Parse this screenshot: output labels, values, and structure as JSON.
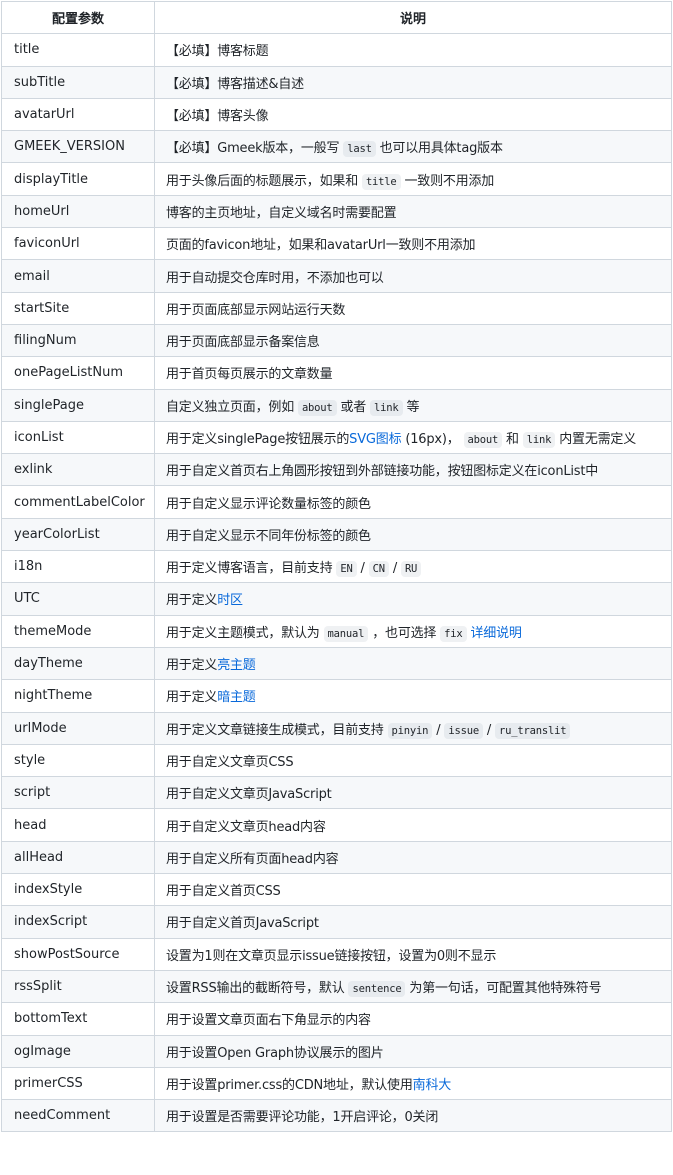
{
  "header": {
    "param": "配置参数",
    "desc": "说明"
  },
  "rows": [
    {
      "key": "title",
      "parts": [
        {
          "t": "text",
          "v": "【必填】博客标题"
        }
      ]
    },
    {
      "key": "subTitle",
      "parts": [
        {
          "t": "text",
          "v": "【必填】博客描述&自述"
        }
      ]
    },
    {
      "key": "avatarUrl",
      "parts": [
        {
          "t": "text",
          "v": "【必填】博客头像"
        }
      ]
    },
    {
      "key": "GMEEK_VERSION",
      "parts": [
        {
          "t": "text",
          "v": "【必填】Gmeek版本，一般写 "
        },
        {
          "t": "code",
          "v": "last"
        },
        {
          "t": "text",
          "v": " 也可以用具体tag版本"
        }
      ]
    },
    {
      "key": "displayTitle",
      "parts": [
        {
          "t": "text",
          "v": "用于头像后面的标题展示，如果和 "
        },
        {
          "t": "code",
          "v": "title"
        },
        {
          "t": "text",
          "v": " 一致则不用添加"
        }
      ]
    },
    {
      "key": "homeUrl",
      "parts": [
        {
          "t": "text",
          "v": "博客的主页地址，自定义域名时需要配置"
        }
      ]
    },
    {
      "key": "faviconUrl",
      "parts": [
        {
          "t": "text",
          "v": "页面的favicon地址，如果和avatarUrl一致则不用添加"
        }
      ]
    },
    {
      "key": "email",
      "parts": [
        {
          "t": "text",
          "v": "用于自动提交仓库时用，不添加也可以"
        }
      ]
    },
    {
      "key": "startSite",
      "parts": [
        {
          "t": "text",
          "v": "用于页面底部显示网站运行天数"
        }
      ]
    },
    {
      "key": "filingNum",
      "parts": [
        {
          "t": "text",
          "v": "用于页面底部显示备案信息"
        }
      ]
    },
    {
      "key": "onePageListNum",
      "parts": [
        {
          "t": "text",
          "v": "用于首页每页展示的文章数量"
        }
      ]
    },
    {
      "key": "singlePage",
      "parts": [
        {
          "t": "text",
          "v": "自定义独立页面，例如 "
        },
        {
          "t": "code",
          "v": "about"
        },
        {
          "t": "text",
          "v": " 或者 "
        },
        {
          "t": "code",
          "v": "link"
        },
        {
          "t": "text",
          "v": " 等"
        }
      ]
    },
    {
      "key": "iconList",
      "parts": [
        {
          "t": "text",
          "v": "用于定义singlePage按钮展示的"
        },
        {
          "t": "link",
          "v": "SVG图标"
        },
        {
          "t": "text",
          "v": " (16px)， "
        },
        {
          "t": "code",
          "v": "about"
        },
        {
          "t": "text",
          "v": " 和 "
        },
        {
          "t": "code",
          "v": "link"
        },
        {
          "t": "text",
          "v": " 内置无需定义"
        }
      ]
    },
    {
      "key": "exlink",
      "parts": [
        {
          "t": "text",
          "v": "用于自定义首页右上角圆形按钮到外部链接功能，按钮图标定义在iconList中"
        }
      ]
    },
    {
      "key": "commentLabelColor",
      "parts": [
        {
          "t": "text",
          "v": "用于自定义显示评论数量标签的颜色"
        }
      ]
    },
    {
      "key": "yearColorList",
      "parts": [
        {
          "t": "text",
          "v": "用于自定义显示不同年份标签的颜色"
        }
      ]
    },
    {
      "key": "i18n",
      "parts": [
        {
          "t": "text",
          "v": "用于定义博客语言，目前支持 "
        },
        {
          "t": "code",
          "v": "EN"
        },
        {
          "t": "text",
          "v": " / "
        },
        {
          "t": "code",
          "v": "CN"
        },
        {
          "t": "text",
          "v": " / "
        },
        {
          "t": "code",
          "v": "RU"
        }
      ]
    },
    {
      "key": "UTC",
      "parts": [
        {
          "t": "text",
          "v": "用于定义"
        },
        {
          "t": "link",
          "v": "时区"
        }
      ]
    },
    {
      "key": "themeMode",
      "parts": [
        {
          "t": "text",
          "v": "用于定义主题模式，默认为 "
        },
        {
          "t": "code",
          "v": "manual"
        },
        {
          "t": "text",
          "v": " ，也可选择 "
        },
        {
          "t": "code",
          "v": "fix"
        },
        {
          "t": "text",
          "v": " "
        },
        {
          "t": "link",
          "v": "详细说明"
        }
      ]
    },
    {
      "key": "dayTheme",
      "parts": [
        {
          "t": "text",
          "v": "用于定义"
        },
        {
          "t": "link",
          "v": "亮主题"
        }
      ]
    },
    {
      "key": "nightTheme",
      "parts": [
        {
          "t": "text",
          "v": "用于定义"
        },
        {
          "t": "link",
          "v": "暗主题"
        }
      ]
    },
    {
      "key": "urlMode",
      "parts": [
        {
          "t": "text",
          "v": "用于定义文章链接生成模式，目前支持 "
        },
        {
          "t": "code",
          "v": "pinyin"
        },
        {
          "t": "text",
          "v": " / "
        },
        {
          "t": "code",
          "v": "issue"
        },
        {
          "t": "text",
          "v": " / "
        },
        {
          "t": "code",
          "v": "ru_translit"
        }
      ]
    },
    {
      "key": "style",
      "parts": [
        {
          "t": "text",
          "v": "用于自定义文章页CSS"
        }
      ]
    },
    {
      "key": "script",
      "parts": [
        {
          "t": "text",
          "v": "用于自定义文章页JavaScript"
        }
      ]
    },
    {
      "key": "head",
      "parts": [
        {
          "t": "text",
          "v": "用于自定义文章页head内容"
        }
      ]
    },
    {
      "key": "allHead",
      "parts": [
        {
          "t": "text",
          "v": "用于自定义所有页面head内容"
        }
      ]
    },
    {
      "key": "indexStyle",
      "parts": [
        {
          "t": "text",
          "v": "用于自定义首页CSS"
        }
      ]
    },
    {
      "key": "indexScript",
      "parts": [
        {
          "t": "text",
          "v": "用于自定义首页JavaScript"
        }
      ]
    },
    {
      "key": "showPostSource",
      "parts": [
        {
          "t": "text",
          "v": "设置为1则在文章页显示issue链接按钮，设置为0则不显示"
        }
      ]
    },
    {
      "key": "rssSplit",
      "parts": [
        {
          "t": "text",
          "v": "设置RSS输出的截断符号，默认 "
        },
        {
          "t": "code",
          "v": "sentence"
        },
        {
          "t": "text",
          "v": " 为第一句话，可配置其他特殊符号"
        }
      ]
    },
    {
      "key": "bottomText",
      "parts": [
        {
          "t": "text",
          "v": "用于设置文章页面右下角显示的内容"
        }
      ]
    },
    {
      "key": "ogImage",
      "parts": [
        {
          "t": "text",
          "v": "用于设置Open Graph协议展示的图片"
        }
      ]
    },
    {
      "key": "primerCSS",
      "parts": [
        {
          "t": "text",
          "v": "用于设置primer.css的CDN地址，默认使用"
        },
        {
          "t": "link",
          "v": "南科大"
        }
      ]
    },
    {
      "key": "needComment",
      "parts": [
        {
          "t": "text",
          "v": "用于设置是否需要评论功能，1开启评论，0关闭"
        }
      ]
    }
  ]
}
